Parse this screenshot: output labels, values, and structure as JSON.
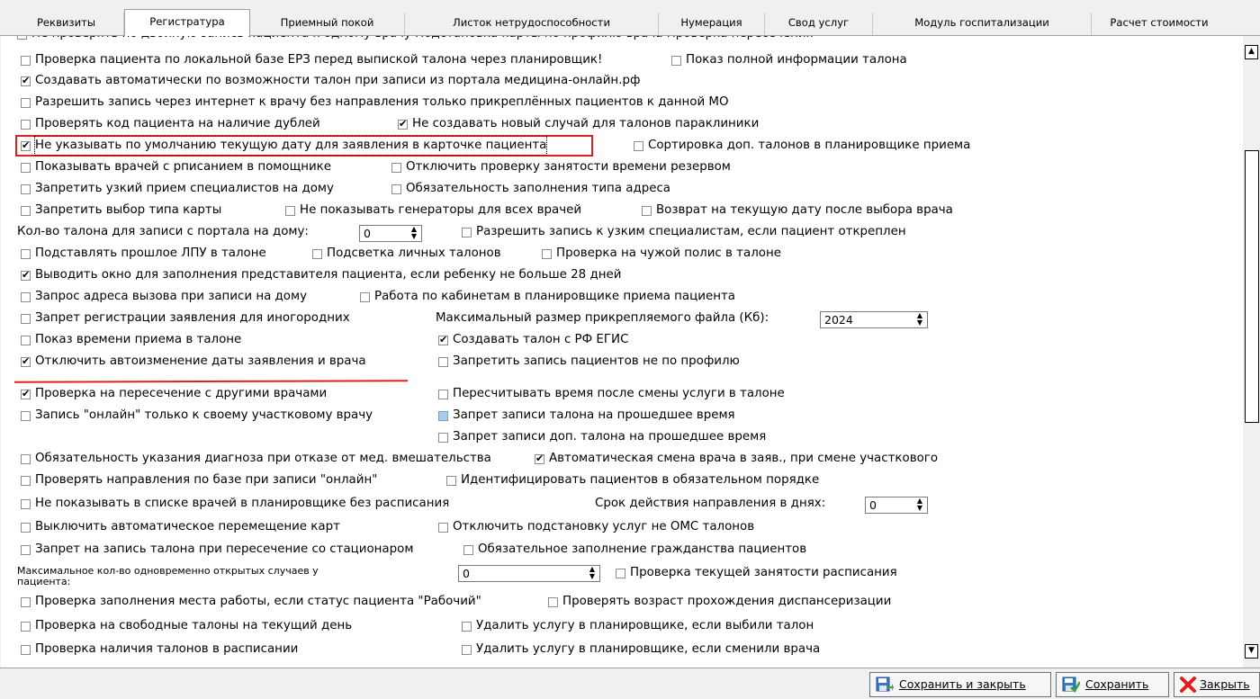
{
  "tabs": [
    "Реквизиты",
    "Регистратура",
    "Приемный покой",
    "Листок нетрудоспособности",
    "Нумерация",
    "Свод услуг",
    "Модуль госпитализации",
    "Расчет стоимости"
  ],
  "active_tab": "Регистратура",
  "partial_top_row": "Не проверять по двойную запись пациента к одному врачу    Подстановка карты по профилю врача    Проверка пересечения",
  "options": [
    {
      "label": "Проверка пациента по локальной базе ЕРЗ перед выпиской талона через планировщик!",
      "checked": false
    },
    {
      "label": "Показ полной информации талона",
      "checked": false
    },
    {
      "label": "Создавать автоматически по возможности талон при записи из портала медицина-онлайн.рф",
      "checked": true
    },
    {
      "label": "Разрешить запись через интернет к врачу без направления только прикреплённых пациентов к данной МО",
      "checked": false
    },
    {
      "label": "Проверять код пациента на наличие дублей",
      "checked": false
    },
    {
      "label": "Не создавать новый случай для талонов параклиники",
      "checked": true
    },
    {
      "label": "Не указывать по умолчанию текущую дату для заявления в карточке пациента",
      "checked": true
    },
    {
      "label": "Сортировка доп. талонов в планировщике приема",
      "checked": false
    },
    {
      "label": "Показывать врачей с рписанием в помощнике",
      "checked": false
    },
    {
      "label": "Отключить проверку занятости времени резервом",
      "checked": false
    },
    {
      "label": "Запретить узкий прием специалистов на дому",
      "checked": false
    },
    {
      "label": "Обязательность заполнения типа адреса",
      "checked": false
    },
    {
      "label": "Запретить выбор типа карты",
      "checked": false
    },
    {
      "label": "Не показывать генераторы для всех врачей",
      "checked": false
    },
    {
      "label": "Возврат на текущую дату после выбора врача",
      "checked": false
    },
    {
      "label": "Разрешить запись к узким специалистам, если пациент откреплен",
      "checked": false
    },
    {
      "label": "Подставлять прошлое ЛПУ в талоне",
      "checked": false
    },
    {
      "label": "Подсветка личных талонов",
      "checked": false
    },
    {
      "label": "Проверка на чужой полис в талоне",
      "checked": false
    },
    {
      "label": "Выводить окно для заполнения представителя пациента, если ребенку не больше 28 дней",
      "checked": true
    },
    {
      "label": "Запрос адреса вызова при записи на дому",
      "checked": false
    },
    {
      "label": "Работа по кабинетам в планировщике приема пациента",
      "checked": false
    },
    {
      "label": "Запрет регистрации заявления для иногородних",
      "checked": false
    },
    {
      "label": "Показ времени приема в талоне",
      "checked": false
    },
    {
      "label": "Создавать талон с РФ ЕГИС",
      "checked": true
    },
    {
      "label": "Отключить автоизменение даты заявления и врача",
      "checked": true
    },
    {
      "label": "Запретить запись пациентов не по профилю",
      "checked": false
    },
    {
      "label": "Проверка на пересечение с другими врачами",
      "checked": true
    },
    {
      "label": "Пересчитывать время после смены услуги в талоне",
      "checked": false
    },
    {
      "label": "Запись \"онлайн\" только к своему участковому врачу",
      "checked": false
    },
    {
      "label": "Запрет записи талона на прошедшее время",
      "checked": false
    },
    {
      "label": "Запрет записи доп. талона на прошедшее время",
      "checked": false
    },
    {
      "label": "Обязательность указания диагноза при отказе от мед. вмешательства",
      "checked": false
    },
    {
      "label": "Автоматическая смена врача в заяв., при смене участкового",
      "checked": true
    },
    {
      "label": "Проверять направления по базе при записи \"онлайн\"",
      "checked": false
    },
    {
      "label": "Идентифицировать пациентов в обязательном порядке",
      "checked": false
    },
    {
      "label": "Не показывать в списке врачей в планировщике без расписания",
      "checked": false
    },
    {
      "label": "Выключить автоматическое перемещение карт",
      "checked": false
    },
    {
      "label": "Отключить подстановку услуг не ОМС талонов",
      "checked": false
    },
    {
      "label": "Запрет на запись талона при пересечение со стационаром",
      "checked": false
    },
    {
      "label": "Обязательное заполнение гражданства пациентов",
      "checked": false
    },
    {
      "label": "Проверка текущей занятости расписания",
      "checked": false
    },
    {
      "label": "Проверка заполнения места работы, если статус пациента \"Рабочий\"",
      "checked": false
    },
    {
      "label": "Проверять возраст прохождения диспансеризации",
      "checked": false
    },
    {
      "label": "Проверка на свободные талоны на текущий день",
      "checked": false
    },
    {
      "label": "Удалить услугу в планировщике, если выбили талон",
      "checked": false
    },
    {
      "label": "Проверка наличия талонов в расписании",
      "checked": false
    },
    {
      "label": "Удалить услугу в планировщике, если сменили врача",
      "checked": false
    }
  ],
  "fields": {
    "portal_home_label": "Кол-во талона для записи с портала на дому:",
    "portal_home_value": "0",
    "max_file_label": "Максимальный размер прикрепляемого файла (Кб):",
    "max_file_value": "2024",
    "referral_days_label": "Срок действия направления в днях:",
    "referral_days_value": "0",
    "max_cases_label": "Максимальное кол-во одновременно открытых случаев у пациента:",
    "max_cases_value": "0"
  },
  "buttons": {
    "save_close": "Сохранить и закрыть",
    "save": "Сохранить",
    "close": "Закрыть"
  },
  "colors": {
    "highlight": "#e02020",
    "checkbox_blue": "#a9cdee"
  }
}
